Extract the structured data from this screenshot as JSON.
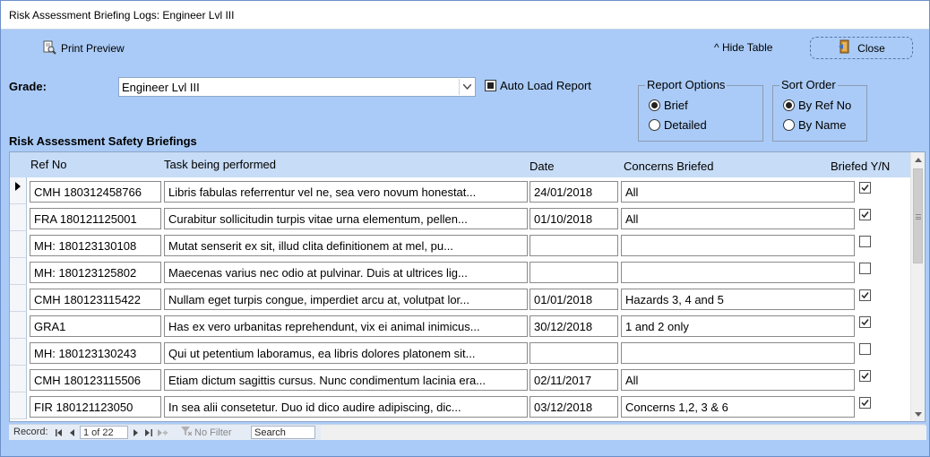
{
  "window": {
    "title": "Risk Assessment Briefing Logs: Engineer Lvl III"
  },
  "toolbar": {
    "print_preview": "Print Preview",
    "hide_table": "^ Hide Table",
    "close": "Close"
  },
  "grade": {
    "label": "Grade:",
    "value": "Engineer Lvl III"
  },
  "auto_load": {
    "label": "Auto Load Report",
    "checked": true
  },
  "report_options": {
    "title": "Report Options",
    "options": [
      "Brief",
      "Detailed"
    ],
    "selected": "Brief"
  },
  "sort_order": {
    "title": "Sort Order",
    "options": [
      "By Ref No",
      "By Name"
    ],
    "selected": "By Ref No"
  },
  "table": {
    "title": "Risk Assessment Safety Briefings",
    "headers": {
      "ref": "Ref No",
      "task": "Task being performed",
      "date": "Date",
      "concerns": "Concerns Briefed",
      "briefed": "Briefed Y/N"
    },
    "rows": [
      {
        "ref": "CMH 180312458766",
        "task": "Libris fabulas referrentur vel ne, sea vero novum honestat...",
        "date": "24/01/2018",
        "concerns": "All",
        "briefed": true
      },
      {
        "ref": "FRA 180121125001",
        "task": "Curabitur sollicitudin turpis vitae urna elementum, pellen...",
        "date": "01/10/2018",
        "concerns": "All",
        "briefed": true
      },
      {
        "ref": "MH: 180123130108",
        "task": "Mutat senserit ex sit, illud clita definitionem at mel, pu...",
        "date": "",
        "concerns": "",
        "briefed": false
      },
      {
        "ref": "MH: 180123125802",
        "task": "Maecenas varius nec odio at pulvinar. Duis at ultrices lig...",
        "date": "",
        "concerns": "",
        "briefed": false
      },
      {
        "ref": "CMH 180123115422",
        "task": "Nullam eget turpis congue, imperdiet arcu at, volutpat lor...",
        "date": "01/01/2018",
        "concerns": "Hazards 3, 4 and 5",
        "briefed": true
      },
      {
        "ref": "GRA1",
        "task": "Has ex vero urbanitas reprehendunt, vix ei animal inimicus...",
        "date": "30/12/2018",
        "concerns": "1 and 2 only",
        "briefed": true
      },
      {
        "ref": "MH: 180123130243",
        "task": "Qui ut petentium laboramus, ea libris dolores platonem sit...",
        "date": "",
        "concerns": "",
        "briefed": false
      },
      {
        "ref": "CMH 180123115506",
        "task": "Etiam dictum sagittis cursus. Nunc condimentum lacinia era...",
        "date": "02/11/2017",
        "concerns": "All",
        "briefed": true
      },
      {
        "ref": "FIR 180121123050",
        "task": "In sea alii consetetur. Duo id dico audire adipiscing, dic...",
        "date": "03/12/2018",
        "concerns": "Concerns 1,2, 3 & 6",
        "briefed": true
      }
    ]
  },
  "navigation": {
    "record_label": "Record:",
    "current": "1 of 22",
    "no_filter": "No Filter",
    "search": "Search"
  },
  "icons": [
    "print-preview-icon",
    "close-door-icon",
    "combo-dropdown-icon",
    "record-selector-arrow-icon",
    "scroll-up-icon",
    "scroll-down-icon",
    "first-record-icon",
    "previous-record-icon",
    "next-record-icon",
    "last-record-icon",
    "new-record-icon",
    "filter-icon"
  ],
  "colors": {
    "form_background": "#aacbf7",
    "header_background": "#c7dcf6"
  }
}
